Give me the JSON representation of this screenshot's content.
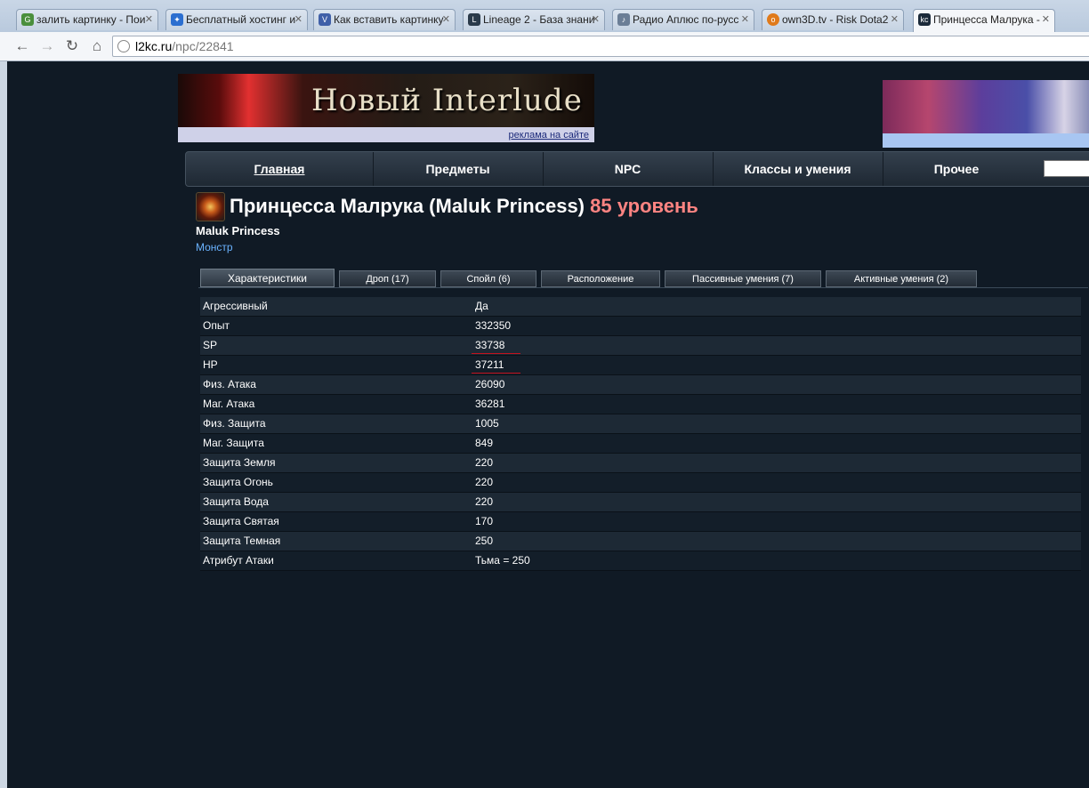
{
  "browser": {
    "tabs": [
      {
        "title": "залить картинку - Пои",
        "favicon_color": "#4a8f3c"
      },
      {
        "title": "Бесплатный хостинг и",
        "favicon_color": "#2c6fd0"
      },
      {
        "title": "Как вставить картинку",
        "favicon_color": "#4060a8"
      },
      {
        "title": "Lineage 2 - База знани",
        "favicon_color": "#2a3a4a"
      },
      {
        "title": "Радио Аплюс по-русс",
        "favicon_color": "#6b7e96"
      },
      {
        "title": "own3D.tv - Risk Dota2",
        "favicon_color": "#e07a1a"
      },
      {
        "title": "Принцесса Малрука -",
        "favicon_color": "#1b2a3a"
      }
    ],
    "url_host": "l2kc.ru",
    "url_path": "/npc/22841"
  },
  "banner": {
    "title": "Новый Interlude",
    "ad_link": "реклама на сайте"
  },
  "nav": {
    "items": [
      "Главная",
      "Предметы",
      "NPC",
      "Классы и умения",
      "Прочее"
    ]
  },
  "npc": {
    "name": "Принцесса Малрука (Maluk Princess)",
    "level": "85 уровень",
    "english_name": "Maluk Princess",
    "type": "Монстр"
  },
  "tabs": [
    {
      "label": "Характеристики",
      "active": true
    },
    {
      "label": "Дроп (17)"
    },
    {
      "label": "Спойл (6)"
    },
    {
      "label": "Расположение"
    },
    {
      "label": "Пассивные умения (7)"
    },
    {
      "label": "Активные умения (2)"
    }
  ],
  "stats": [
    {
      "key": "Агрессивный",
      "value": "Да"
    },
    {
      "key": "Опыт",
      "value": "332350"
    },
    {
      "key": "SP",
      "value": "33738"
    },
    {
      "key": "HP",
      "value": "37211"
    },
    {
      "key": "Физ. Атака",
      "value": "26090"
    },
    {
      "key": "Маг. Атака",
      "value": "36281"
    },
    {
      "key": "Физ. Защита",
      "value": "1005"
    },
    {
      "key": "Маг. Защита",
      "value": "849"
    },
    {
      "key": "Защита Земля",
      "value": "220"
    },
    {
      "key": "Защита Огонь",
      "value": "220"
    },
    {
      "key": "Защита Вода",
      "value": "220"
    },
    {
      "key": "Защита Святая",
      "value": "170"
    },
    {
      "key": "Защита Темная",
      "value": "250"
    },
    {
      "key": "Атрибут Атаки",
      "value": "Тьма = 250"
    }
  ]
}
